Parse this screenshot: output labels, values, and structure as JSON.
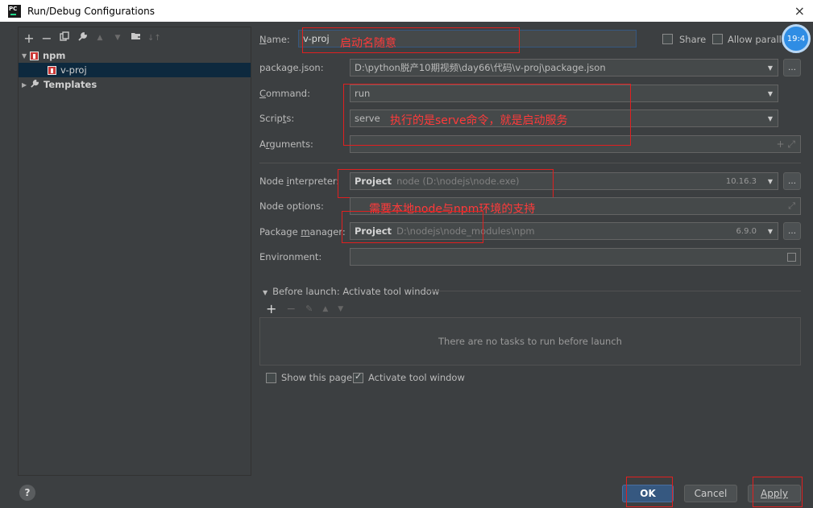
{
  "window": {
    "title": "Run/Debug Configurations",
    "logo": "PC",
    "close": "×"
  },
  "left": {
    "toolbar_icons": [
      "+",
      "−",
      "⧉",
      "wrench-icon",
      "▲",
      "▼",
      "folder-icon",
      "sort-icon"
    ],
    "tree": [
      {
        "label": "npm",
        "expanded": true
      },
      {
        "label": "v-proj",
        "selected": true
      },
      {
        "label": "Templates",
        "expanded": false
      }
    ]
  },
  "form": {
    "name_label": "Name:",
    "name_value": "v-proj",
    "share_label": "Share",
    "allow_parallel_label": "Allow paralle",
    "package_json_label": "package.json:",
    "package_json_value": "D:\\python脱产10期视频\\day66\\代码\\v-proj\\package.json",
    "command_label": "Command:",
    "command_value": "run",
    "scripts_label": "Scripts:",
    "scripts_value": "serve",
    "arguments_label": "Arguments:",
    "node_interpreter_label": "Node interpreter:",
    "node_interpreter_prefix": "Project",
    "node_interpreter_value": "node (D:\\nodejs\\node.exe)",
    "node_version": "10.16.3",
    "node_options_label": "Node options:",
    "package_manager_label": "Package manager:",
    "package_manager_prefix": "Project",
    "package_manager_value": "D:\\nodejs\\node_modules\\npm",
    "npm_version": "6.9.0",
    "environment_label": "Environment:",
    "before_launch_label": "Before launch: Activate tool window",
    "no_tasks_text": "There are no tasks to run before launch",
    "show_page_label": "Show this page",
    "activate_tool_label": "Activate tool window"
  },
  "annotations": {
    "name_note": "启动名随意",
    "scripts_note": "执行的是serve命令，就是启动服务",
    "env_note": "需要本地node与npm环境的支持"
  },
  "buttons": {
    "ok": "OK",
    "cancel": "Cancel",
    "apply": "Apply",
    "help": "?"
  },
  "badge": "19:4",
  "colors": {
    "accent": "#365880",
    "annotation": "#ff3a3a",
    "background": "#3c3f41"
  }
}
